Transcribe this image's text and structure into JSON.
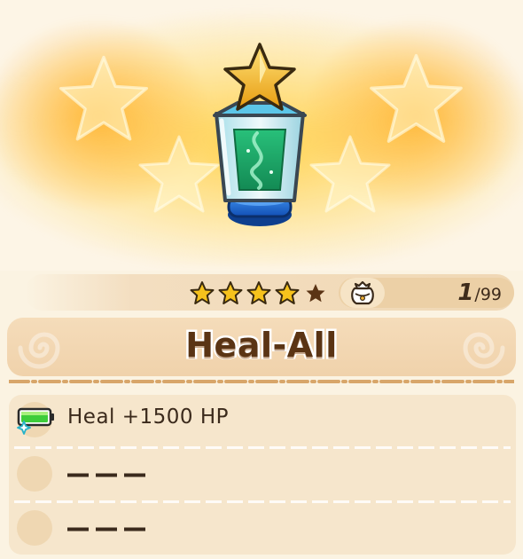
{
  "item": {
    "name": "Heal-All",
    "rarity_stars_filled": 4,
    "rarity_stars_total": 5,
    "icon": "heal-all-potion-icon"
  },
  "inventory": {
    "icon": "item-bag-icon",
    "count": "1",
    "max": "/99"
  },
  "effects": [
    {
      "icon": "battery-heal-icon",
      "text": "Heal +1500 HP"
    },
    {
      "icon": "empty-slot-icon",
      "text": "———"
    },
    {
      "icon": "empty-slot-icon",
      "text": "———"
    }
  ],
  "colors": {
    "title_text": "#5a3414",
    "glow": "#ffce40",
    "potion_liquid": "#1ea26a",
    "star_gold": "#f5b818"
  }
}
